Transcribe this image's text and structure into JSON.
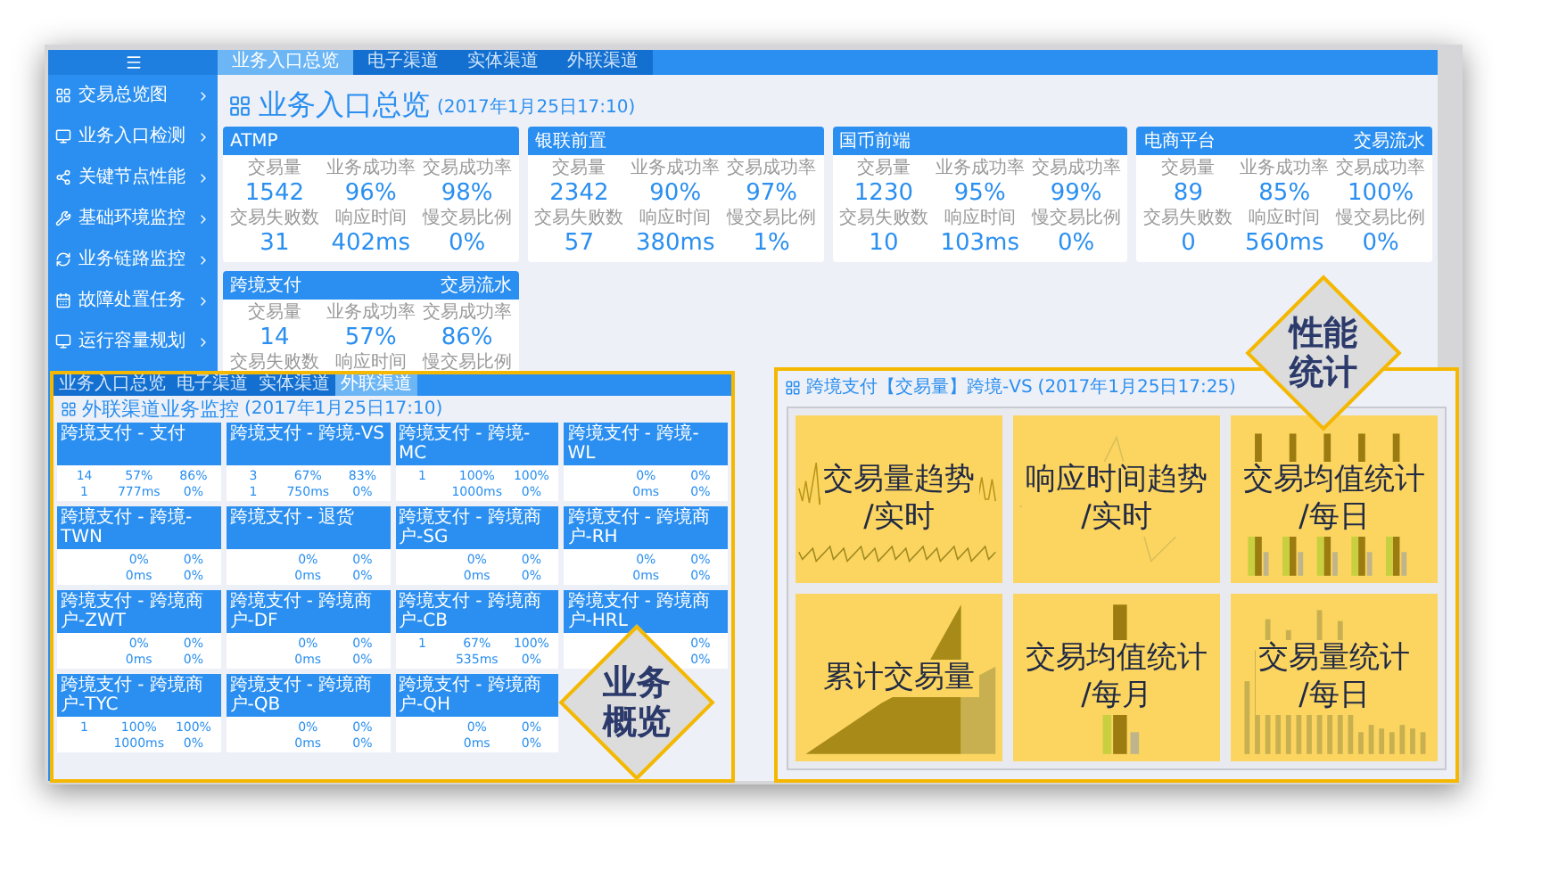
{
  "sidebar": {
    "items": [
      {
        "label": "交易总览图"
      },
      {
        "label": "业务入口检测"
      },
      {
        "label": "关键节点性能"
      },
      {
        "label": "基础环境监控"
      },
      {
        "label": "业务链路监控"
      },
      {
        "label": "故障处置任务"
      },
      {
        "label": "运行容量规划"
      }
    ]
  },
  "tabs": [
    {
      "label": "业务入口总览",
      "selected": true
    },
    {
      "label": "电子渠道",
      "selected": false
    },
    {
      "label": "实体渠道",
      "selected": false
    },
    {
      "label": "外联渠道",
      "selected": false
    }
  ],
  "page_title": "业务入口总览",
  "page_time": "(2017年1月25日17:10)",
  "cards": [
    {
      "title": "ATMP",
      "metrics": [
        {
          "label": "交易量",
          "value": "1542"
        },
        {
          "label": "业务成功率",
          "value": "96%"
        },
        {
          "label": "交易成功率",
          "value": "98%"
        },
        {
          "label": "交易失败数",
          "value": "31"
        },
        {
          "label": "响应时间",
          "value": "402ms"
        },
        {
          "label": "慢交易比例",
          "value": "0%"
        }
      ]
    },
    {
      "title": "银联前置",
      "metrics": [
        {
          "label": "交易量",
          "value": "2342"
        },
        {
          "label": "业务成功率",
          "value": "90%"
        },
        {
          "label": "交易成功率",
          "value": "97%"
        },
        {
          "label": "交易失败数",
          "value": "57"
        },
        {
          "label": "响应时间",
          "value": "380ms"
        },
        {
          "label": "慢交易比例",
          "value": "1%"
        }
      ]
    },
    {
      "title": "国币前端",
      "metrics": [
        {
          "label": "交易量",
          "value": "1230"
        },
        {
          "label": "业务成功率",
          "value": "95%"
        },
        {
          "label": "交易成功率",
          "value": "99%"
        },
        {
          "label": "交易失败数",
          "value": "10"
        },
        {
          "label": "响应时间",
          "value": "103ms"
        },
        {
          "label": "慢交易比例",
          "value": "0%"
        }
      ]
    },
    {
      "title": "电商平台",
      "link": "交易流水",
      "metrics": [
        {
          "label": "交易量",
          "value": "89"
        },
        {
          "label": "业务成功率",
          "value": "85%"
        },
        {
          "label": "交易成功率",
          "value": "100%"
        },
        {
          "label": "交易失败数",
          "value": "0"
        },
        {
          "label": "响应时间",
          "value": "560ms"
        },
        {
          "label": "慢交易比例",
          "value": "0%"
        }
      ]
    },
    {
      "title": "跨境支付",
      "link": "交易流水",
      "metrics": [
        {
          "label": "交易量",
          "value": "14"
        },
        {
          "label": "业务成功率",
          "value": "57%"
        },
        {
          "label": "交易成功率",
          "value": "86%"
        },
        {
          "label": "交易失败数"
        },
        {
          "label": "响应时间"
        },
        {
          "label": "慢交易比例"
        }
      ]
    }
  ],
  "overview_inset": {
    "tabs": [
      {
        "label": "业务入口总览",
        "selected": false
      },
      {
        "label": "电子渠道",
        "selected": false
      },
      {
        "label": "实体渠道",
        "selected": false
      },
      {
        "label": "外联渠道",
        "selected": true
      }
    ],
    "title": "外联渠道业务监控",
    "time": "(2017年1月25日17:10)",
    "cards": [
      {
        "title": "跨境支付 - 支付",
        "row_1": {
          "col_1": "14",
          "col_2": "57%",
          "col_3": "86%"
        },
        "row_2": {
          "col_1": "1",
          "col_2": "777ms",
          "col_3": "0%"
        }
      },
      {
        "title": "跨境支付 - 跨境-VS",
        "row_1": {
          "col_1": "3",
          "col_2": "67%",
          "col_3": "83%"
        },
        "row_2": {
          "col_1": "1",
          "col_2": "750ms",
          "col_3": "0%"
        }
      },
      {
        "title": "跨境支付 - 跨境-MC",
        "row_1": {
          "col_1": "1",
          "col_2": "100%",
          "col_3": "100%"
        },
        "row_2": {
          "col_2": "1000ms",
          "col_3": "0%"
        }
      },
      {
        "title": "跨境支付 - 跨境-WL",
        "row_1": {
          "col_2": "0%",
          "col_3": "0%"
        },
        "row_2": {
          "col_2": "0ms",
          "col_3": "0%"
        }
      },
      {
        "title": "跨境支付 - 跨境-TWN",
        "row_1": {
          "col_2": "0%",
          "col_3": "0%"
        },
        "row_2": {
          "col_2": "0ms",
          "col_3": "0%"
        }
      },
      {
        "title": "跨境支付 - 退货",
        "row_1": {
          "col_2": "0%",
          "col_3": "0%"
        },
        "row_2": {
          "col_2": "0ms",
          "col_3": "0%"
        }
      },
      {
        "title": "跨境支付 - 跨境商户-SG",
        "row_1": {
          "col_2": "0%",
          "col_3": "0%"
        },
        "row_2": {
          "col_2": "0ms",
          "col_3": "0%"
        }
      },
      {
        "title": "跨境支付 - 跨境商户-RH",
        "row_1": {
          "col_2": "0%",
          "col_3": "0%"
        },
        "row_2": {
          "col_2": "0ms",
          "col_3": "0%"
        }
      },
      {
        "title": "跨境支付 - 跨境商户-ZWT",
        "row_1": {
          "col_2": "0%",
          "col_3": "0%"
        },
        "row_2": {
          "col_2": "0ms",
          "col_3": "0%"
        }
      },
      {
        "title": "跨境支付 - 跨境商户-DF",
        "row_1": {
          "col_2": "0%",
          "col_3": "0%"
        },
        "row_2": {
          "col_2": "0ms",
          "col_3": "0%"
        }
      },
      {
        "title": "跨境支付 - 跨境商户-CB",
        "row_1": {
          "col_1": "1",
          "col_2": "67%",
          "col_3": "100%"
        },
        "row_2": {
          "col_2": "535ms",
          "col_3": "0%"
        }
      },
      {
        "title": "跨境支付 - 跨境商户-HRL",
        "row_1": {
          "col_3": "0%"
        },
        "row_2": {
          "col_3": "0%"
        }
      },
      {
        "title": "跨境支付 - 跨境商户-TYC",
        "row_1": {
          "col_1": "1",
          "col_2": "100%",
          "col_3": "100%"
        },
        "row_2": {
          "col_2": "1000ms",
          "col_3": "0%"
        }
      },
      {
        "title": "跨境支付 - 跨境商户-QB",
        "row_1": {
          "col_2": "0%",
          "col_3": "0%"
        },
        "row_2": {
          "col_2": "0ms",
          "col_3": "0%"
        }
      },
      {
        "title": "跨境支付 - 跨境商户-QH",
        "row_1": {
          "col_2": "0%",
          "col_3": "0%"
        },
        "row_2": {
          "col_2": "0ms",
          "col_3": "0%"
        }
      }
    ],
    "badge": "业务概览"
  },
  "performance_inset": {
    "title": "跨境支付【交易量】跨境-VS",
    "time": "(2017年1月25日17:25)",
    "panels": [
      {
        "kind": "noisy-line",
        "caption": "交易量趋势\n/实时"
      },
      {
        "kind": "line",
        "caption": "响应时间趋势\n/实时"
      },
      {
        "kind": "tall-bars",
        "caption": "交易均值统计\n/每日"
      },
      {
        "kind": "area",
        "caption": "累计交易量"
      },
      {
        "kind": "single-bar",
        "caption": "交易均值统计\n/每月"
      },
      {
        "kind": "bars",
        "caption": "交易量统计\n/每日"
      }
    ],
    "badge": "性能统计"
  }
}
